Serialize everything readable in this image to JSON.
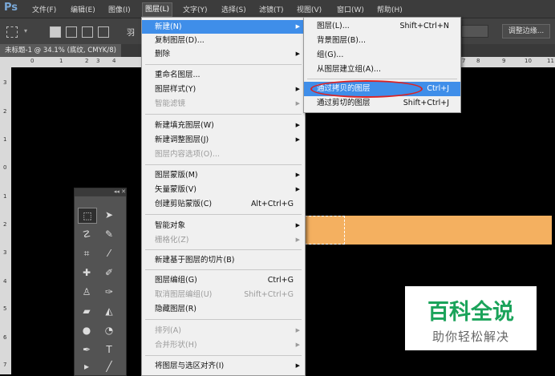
{
  "app": {
    "logo": "Ps"
  },
  "menubar": [
    {
      "label": "文件(F)"
    },
    {
      "label": "编辑(E)"
    },
    {
      "label": "图像(I)"
    },
    {
      "label": "图层(L)"
    },
    {
      "label": "文字(Y)"
    },
    {
      "label": "选择(S)"
    },
    {
      "label": "滤镜(T)"
    },
    {
      "label": "视图(V)"
    },
    {
      "label": "窗口(W)"
    },
    {
      "label": "帮助(H)"
    }
  ],
  "options": {
    "partial_text": "羽",
    "adjust_edge": "调整边缘..."
  },
  "document": {
    "tab_title": "未标题-1 @ 34.1% (底纹, CMYK/8)"
  },
  "ruler": {
    "h_ticks": [
      "0",
      "1",
      "2",
      "3",
      "4",
      "5",
      "7",
      "8",
      "9",
      "10",
      "11"
    ],
    "v_ticks": [
      "3",
      "2",
      "1",
      "0",
      "1",
      "2",
      "3",
      "4",
      "5",
      "6",
      "7"
    ]
  },
  "tools": {
    "collapse": "◂◂ ✕"
  },
  "layer_menu": {
    "items": [
      {
        "label": "新建(N)",
        "shortcut": "",
        "submenu": true,
        "highlighted": true
      },
      {
        "label": "复制图层(D)...",
        "shortcut": ""
      },
      {
        "label": "删除",
        "shortcut": "",
        "submenu": true
      },
      {
        "label": "重命名图层...",
        "shortcut": ""
      },
      {
        "label": "图层样式(Y)",
        "shortcut": "",
        "submenu": true
      },
      {
        "label": "智能滤镜",
        "shortcut": "",
        "submenu": true,
        "disabled": true
      },
      {
        "label": "新建填充图层(W)",
        "shortcut": "",
        "submenu": true
      },
      {
        "label": "新建调整图层(J)",
        "shortcut": "",
        "submenu": true
      },
      {
        "label": "图层内容选项(O)...",
        "shortcut": "",
        "disabled": true
      },
      {
        "label": "图层蒙版(M)",
        "shortcut": "",
        "submenu": true
      },
      {
        "label": "矢量蒙版(V)",
        "shortcut": "",
        "submenu": true
      },
      {
        "label": "创建剪贴蒙版(C)",
        "shortcut": "Alt+Ctrl+G"
      },
      {
        "label": "智能对象",
        "shortcut": "",
        "submenu": true
      },
      {
        "label": "栅格化(Z)",
        "shortcut": "",
        "submenu": true,
        "disabled": true
      },
      {
        "label": "新建基于图层的切片(B)",
        "shortcut": ""
      },
      {
        "label": "图层编组(G)",
        "shortcut": "Ctrl+G"
      },
      {
        "label": "取消图层编组(U)",
        "shortcut": "Shift+Ctrl+G",
        "disabled": true
      },
      {
        "label": "隐藏图层(R)",
        "shortcut": ""
      },
      {
        "label": "排列(A)",
        "shortcut": "",
        "submenu": true,
        "disabled": true
      },
      {
        "label": "合并形状(H)",
        "shortcut": "",
        "submenu": true,
        "disabled": true
      },
      {
        "label": "将图层与选区对齐(I)",
        "shortcut": "",
        "submenu": true
      }
    ]
  },
  "new_submenu": {
    "items": [
      {
        "label": "图层(L)...",
        "shortcut": "Shift+Ctrl+N"
      },
      {
        "label": "背景图层(B)...",
        "shortcut": ""
      },
      {
        "label": "组(G)...",
        "shortcut": ""
      },
      {
        "label": "从图层建立组(A)...",
        "shortcut": ""
      },
      {
        "label": "通过拷贝的图层",
        "shortcut": "Ctrl+J",
        "highlighted": true
      },
      {
        "label": "通过剪切的图层",
        "shortcut": "Shift+Ctrl+J"
      }
    ]
  },
  "watermark": {
    "title": "百科全说",
    "subtitle": "助你轻松解决"
  },
  "colors": {
    "highlight": "#3f8ee9",
    "canvas_fill": "#f4b060",
    "annotation": "#dd2222",
    "watermark_green": "#1aa35a"
  }
}
